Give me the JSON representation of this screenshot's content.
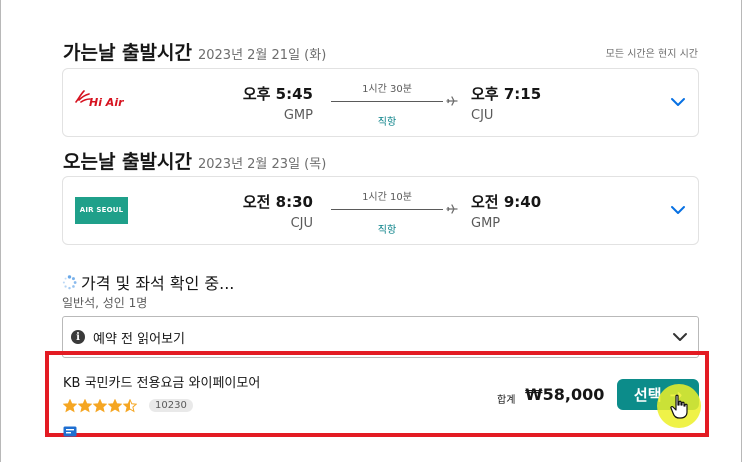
{
  "outbound": {
    "title": "가는날 출발시간",
    "date": "2023년 2월 21일 (화)",
    "tz_note": "모든 시간은 현지 시간",
    "airline_logo": "Hi Air",
    "dep_time": "오후 5:45",
    "dep_code": "GMP",
    "duration": "1시간 30분",
    "stops": "직항",
    "arr_time": "오후 7:15",
    "arr_code": "CJU"
  },
  "inbound": {
    "title": "오는날 출발시간",
    "date": "2023년 2월 23일 (목)",
    "airline_logo": "AIR SEOUL",
    "dep_time": "오전 8:30",
    "dep_code": "CJU",
    "duration": "1시간 10분",
    "stops": "직항",
    "arr_time": "오전 9:40",
    "arr_code": "GMP"
  },
  "status": {
    "loading": "가격 및 좌석 확인 중...",
    "passengers": "일반석, 성인 1명"
  },
  "readmore": {
    "label": "예약 전 읽어보기"
  },
  "offer": {
    "provider": "KB 국민카드 전용요금 와이페이모어",
    "rating": 4.5,
    "review_count": "10230",
    "total_label": "합계",
    "price": "₩58,000",
    "select_label": "선택",
    "arrow": "→"
  },
  "colors": {
    "accent": "#0c8c8a",
    "direct": "#0c838a",
    "chevron": "#0770e3",
    "star": "#f5a623",
    "highlight": "#e31b23",
    "hiair": "#d6121f",
    "airseoul": "#1fa08a"
  }
}
